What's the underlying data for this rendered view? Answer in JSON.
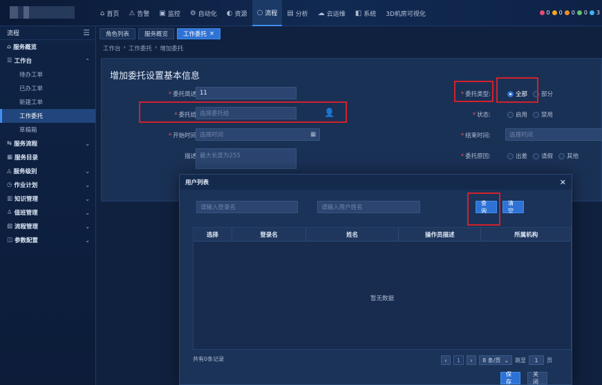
{
  "nav": {
    "items": [
      {
        "icon": "home-icon",
        "glyph": "⌂",
        "label": "首页"
      },
      {
        "icon": "alarm-icon",
        "glyph": "⚠",
        "label": "告警"
      },
      {
        "icon": "monitor-icon",
        "glyph": "▣",
        "label": "监控"
      },
      {
        "icon": "automation-icon",
        "glyph": "⚙",
        "label": "自动化"
      },
      {
        "icon": "resource-icon",
        "glyph": "◐",
        "label": "资源"
      },
      {
        "icon": "process-icon",
        "glyph": "○",
        "label": "流程"
      },
      {
        "icon": "analysis-icon",
        "glyph": "▤",
        "label": "分析"
      },
      {
        "icon": "cloud-ops-icon",
        "glyph": "☁",
        "label": "云运维"
      },
      {
        "icon": "system-icon",
        "glyph": "◧",
        "label": "系统"
      },
      {
        "icon": "",
        "glyph": "",
        "label": "3D机房可视化"
      }
    ],
    "active_index": 5,
    "status_dots": [
      {
        "color": "#e64b7a",
        "count": "0"
      },
      {
        "color": "#f5a623",
        "count": "0"
      },
      {
        "color": "#f08c2c",
        "count": "0"
      },
      {
        "color": "#5ec26a",
        "count": "0"
      },
      {
        "color": "#3fb2f0",
        "count": "3"
      }
    ]
  },
  "sidebar": {
    "header": "流程",
    "items": [
      {
        "label": "服务概览",
        "icon": "home-icon",
        "glyph": "⌂",
        "expandable": false
      },
      {
        "label": "工作台",
        "icon": "desk-icon",
        "glyph": "☰",
        "expandable": true,
        "expanded": true,
        "children": [
          {
            "label": "待办工单",
            "active": false
          },
          {
            "label": "已办工单",
            "active": false
          },
          {
            "label": "新建工单",
            "active": false
          },
          {
            "label": "工作委托",
            "active": true
          },
          {
            "label": "草稿箱",
            "active": false
          }
        ]
      },
      {
        "label": "服务流程",
        "icon": "flow-icon",
        "glyph": "⇆",
        "expandable": true
      },
      {
        "label": "服务目录",
        "icon": "catalog-icon",
        "glyph": "▦",
        "expandable": false
      },
      {
        "label": "服务级别",
        "icon": "level-icon",
        "glyph": "◬",
        "expandable": true
      },
      {
        "label": "作业计划",
        "icon": "plan-icon",
        "glyph": "◷",
        "expandable": true
      },
      {
        "label": "知识管理",
        "icon": "knowledge-icon",
        "glyph": "▥",
        "expandable": true
      },
      {
        "label": "值班管理",
        "icon": "duty-icon",
        "glyph": "♙",
        "expandable": true
      },
      {
        "label": "流程管理",
        "icon": "process-manage-icon",
        "glyph": "▧",
        "expandable": true
      },
      {
        "label": "参数配置",
        "icon": "config-icon",
        "glyph": "◫",
        "expandable": true
      }
    ]
  },
  "tabs": [
    {
      "label": "角色列表",
      "active": false,
      "closable": false
    },
    {
      "label": "服务概览",
      "active": false,
      "closable": false
    },
    {
      "label": "工作委托",
      "active": true,
      "closable": true
    }
  ],
  "breadcrumb": [
    "工作台",
    "工作委托",
    "增加委托"
  ],
  "form": {
    "title": "增加委托设置基本信息",
    "desc_label": "委托简述:",
    "desc_value": "11",
    "delegate_label": "委托给:",
    "delegate_placeholder": "选择委托给",
    "start_label": "开始时间:",
    "start_placeholder": "选择时间",
    "remark_label": "描述:",
    "remark_placeholder": "最大长度为255",
    "type_label": "委托类型:",
    "type_options": [
      "全部",
      "部分"
    ],
    "type_selected": 0,
    "status_label": "状态:",
    "status_options": [
      "启用",
      "禁用"
    ],
    "end_label": "结束时间:",
    "end_placeholder": "选择时间",
    "reason_label": "委托原因:",
    "reason_options": [
      "出差",
      "请假",
      "其他"
    ]
  },
  "modal": {
    "title": "用户列表",
    "login_placeholder": "请输入登录名",
    "name_placeholder": "请输入用户姓名",
    "query_label": "查询",
    "clear_label": "清空",
    "columns": [
      "选择",
      "登录名",
      "姓名",
      "操作员描述",
      "所属机构"
    ],
    "empty_text": "暂无数据",
    "total_text": "共有0条记录",
    "page": "1",
    "page_size": "8 条/页",
    "jump_label": "跳至",
    "jump_value": "1",
    "page_unit": "页",
    "save_label": "保存",
    "close_label": "关闭"
  }
}
